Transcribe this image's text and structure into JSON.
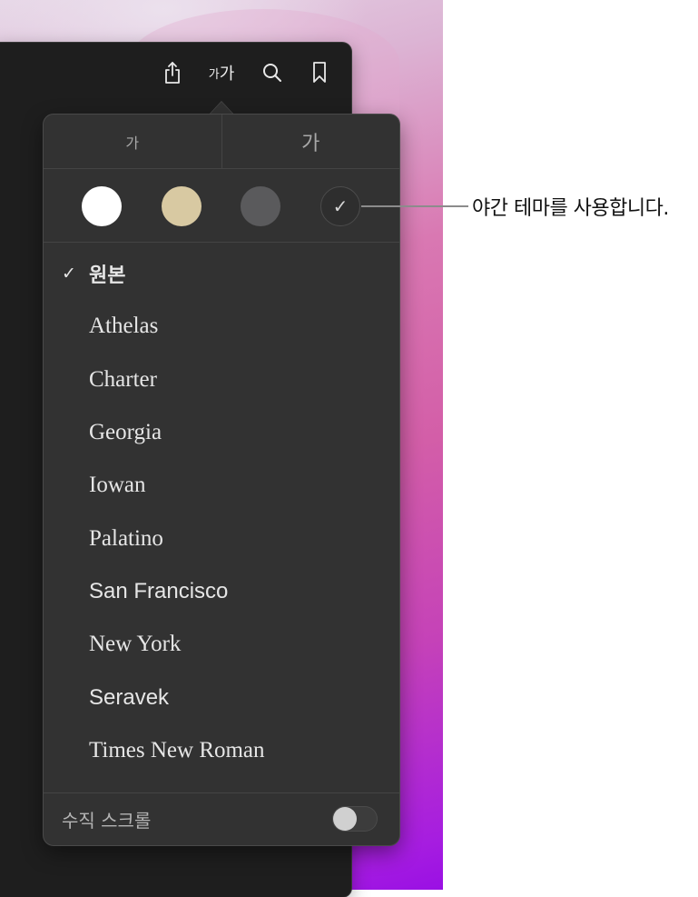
{
  "toolbar": {
    "icons": [
      {
        "name": "share-icon",
        "glyph": "⇪"
      },
      {
        "name": "font-size-icon",
        "label_small": "가",
        "label_large": "가"
      },
      {
        "name": "search-icon",
        "glyph": "⌕"
      },
      {
        "name": "bookmark-icon",
        "glyph": ""
      }
    ]
  },
  "popover": {
    "size_buttons": {
      "smaller": "가",
      "larger": "가"
    },
    "themes": [
      {
        "name": "white",
        "color": "#ffffff",
        "selected": false
      },
      {
        "name": "sepia",
        "color": "#d8c9a2",
        "selected": false
      },
      {
        "name": "gray",
        "color": "#5a5a5c",
        "selected": false
      },
      {
        "name": "night",
        "color": "#2e2e2e",
        "selected": true,
        "check": "✓"
      }
    ],
    "fonts": [
      {
        "label": "원본",
        "selected": true,
        "check": "✓"
      },
      {
        "label": "Athelas",
        "selected": false
      },
      {
        "label": "Charter",
        "selected": false
      },
      {
        "label": "Georgia",
        "selected": false
      },
      {
        "label": "Iowan",
        "selected": false
      },
      {
        "label": "Palatino",
        "selected": false
      },
      {
        "label": "San Francisco",
        "selected": false
      },
      {
        "label": "New York",
        "selected": false
      },
      {
        "label": "Seravek",
        "selected": false
      },
      {
        "label": "Times New Roman",
        "selected": false
      }
    ],
    "vertical_scroll": {
      "label": "수직 스크롤",
      "enabled": false
    }
  },
  "callout": {
    "text": "야간 테마를 사용합니다."
  }
}
